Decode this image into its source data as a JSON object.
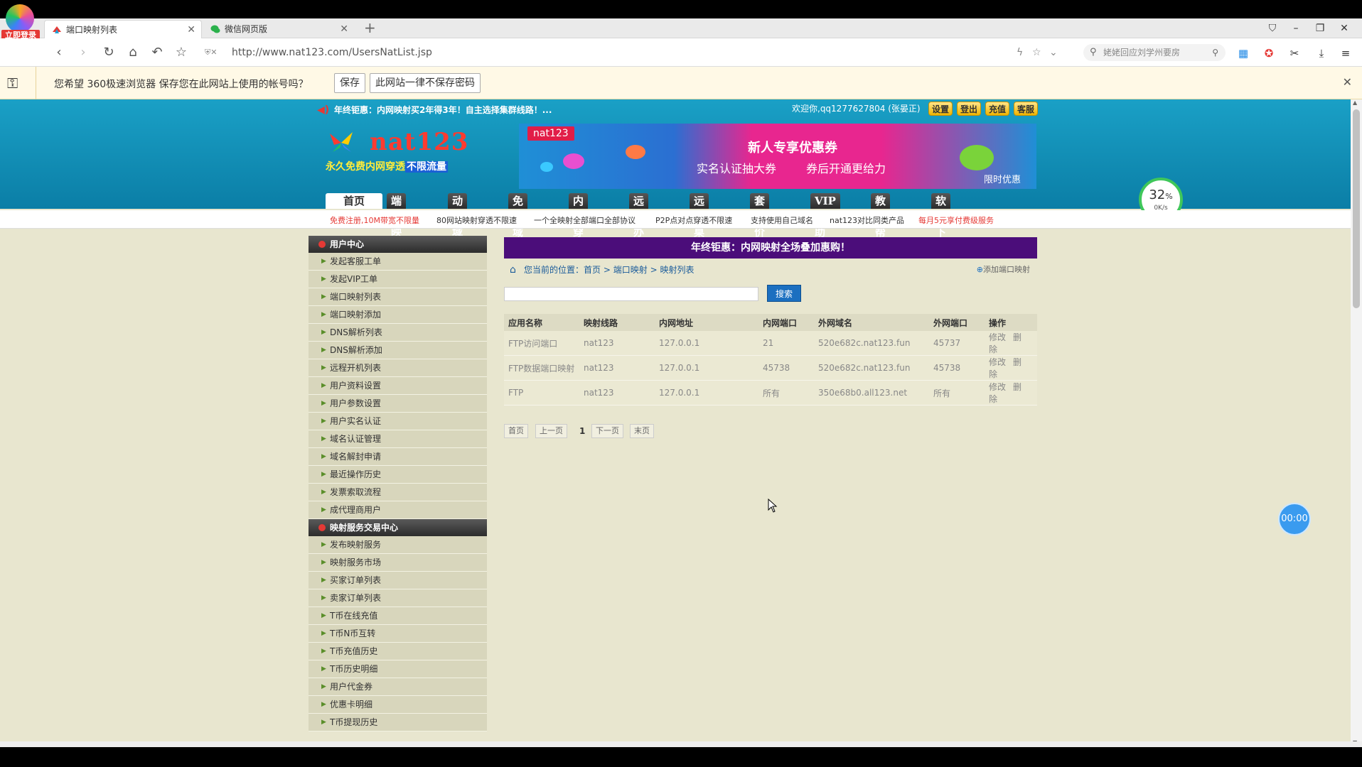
{
  "browser": {
    "login_badge": "立即登录",
    "tabs": [
      {
        "title": "端口映射列表",
        "active": true
      },
      {
        "title": "微信网页版",
        "active": false
      }
    ],
    "url": "http://www.nat123.com/UsersNatList.jsp",
    "search_placeholder": "姥姥回应刘学州要房",
    "password_prompt": {
      "message": "您希望 360极速浏览器 保存您在此网站上使用的帐号吗？",
      "save": "保存",
      "never": "此网站一律不保存密码"
    }
  },
  "header": {
    "notice": "年终钜惠：内网映射买2年得3年！自主选择集群线路！...",
    "welcome": "欢迎你,qq1277627804 (张晏正)",
    "buttons": [
      "设置",
      "登出",
      "充值",
      "客服"
    ],
    "brand": {
      "name": "nat123",
      "slogan_a": "永久免费内网穿透",
      "slogan_b": "不限流量"
    },
    "banner": {
      "tag": "nat123",
      "title": "新人专享优惠券",
      "line_a": "实名认证抽大券",
      "line_b": "券后开通更给力",
      "line_c": "限时优惠"
    },
    "nav": [
      "首页",
      "端口映射",
      "动态域名",
      "免费域名",
      "内网穿透",
      "远程办公",
      "远程桌面",
      "套餐价格",
      "VIP帮助",
      "教程帮助",
      "软件下载"
    ],
    "speed": {
      "pct": "32",
      "unit": "%",
      "rate": "0K/s"
    },
    "subnav": [
      {
        "text": "免费注册,10M带宽不限量",
        "red": true
      },
      {
        "text": "80网站映射穿透不限速",
        "red": false
      },
      {
        "text": "一个全映射全部端口全部协议",
        "red": false
      },
      {
        "text": "P2P点对点穿透不限速",
        "red": false
      },
      {
        "text": "支持使用自己域名",
        "red": false
      },
      {
        "text": "nat123对比同类产品",
        "red": false
      },
      {
        "text": "每月5元享付费级服务",
        "red": true
      }
    ]
  },
  "sidebar": {
    "group1": "用户中心",
    "items1": [
      "发起客服工单",
      "发起VIP工单",
      "端口映射列表",
      "端口映射添加",
      "DNS解析列表",
      "DNS解析添加",
      "远程开机列表",
      "用户资料设置",
      "用户参数设置",
      "用户实名认证",
      "域名认证管理",
      "域名解封申请",
      "最近操作历史",
      "发票索取流程",
      "成代理商用户"
    ],
    "group2": "映射服务交易中心",
    "items2": [
      "发布映射服务",
      "映射服务市场",
      "买家订单列表",
      "卖家订单列表",
      "T币在线充值",
      "T币N币互转",
      "T币充值历史",
      "T币历史明细",
      "用户代金券",
      "优惠卡明细",
      "T币提现历史"
    ]
  },
  "content": {
    "promo": "年终钜惠：内网映射全场叠加惠购！",
    "breadcrumb": {
      "prefix": "您当前的位置：",
      "home": "首页",
      "sep": ">",
      "level2": "端口映射",
      "level3": "映射列表"
    },
    "add_link": "添加端口映射",
    "search_button": "搜索",
    "search_value": "",
    "columns": [
      "应用名称",
      "映射线路",
      "内网地址",
      "内网端口",
      "外网域名",
      "外网端口",
      "操作"
    ],
    "rows": [
      {
        "name": "FTP访问端口",
        "line": "nat123",
        "addr": "127.0.0.1",
        "lport": "21",
        "domain": "520e682c.nat123.fun",
        "wport": "45737",
        "edit": "修改",
        "del": "删除"
      },
      {
        "name": "FTP数据端口映射",
        "line": "nat123",
        "addr": "127.0.0.1",
        "lport": "45738",
        "domain": "520e682c.nat123.fun",
        "wport": "45738",
        "edit": "修改",
        "del": "删除"
      },
      {
        "name": "FTP",
        "line": "nat123",
        "addr": "127.0.0.1",
        "lport": "所有",
        "domain": "350e68b0.all123.net",
        "wport": "所有",
        "edit": "修改",
        "del": "删除"
      }
    ],
    "pager": {
      "first": "首页",
      "prev": "上一页",
      "current": "1",
      "next": "下一页",
      "last": "末页"
    }
  },
  "overlay": {
    "timer": "00:00"
  }
}
